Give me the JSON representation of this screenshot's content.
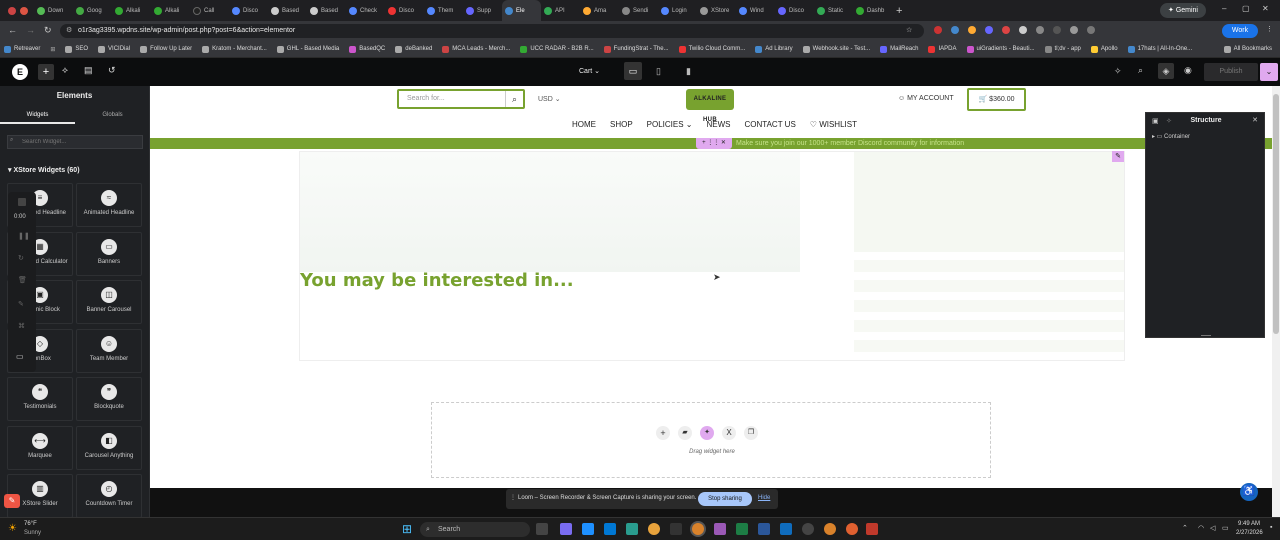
{
  "browser": {
    "tabs": [
      "Down",
      "Goog",
      "Alkali",
      "Alkali",
      "Call",
      "Disco",
      "Based",
      "Based",
      "Check",
      "Disco",
      "Them",
      "Supp",
      "Ele",
      "API",
      "Ama",
      "Sendi",
      "Login",
      "XStore",
      "Wind",
      "Disco",
      "Static",
      "Dashb"
    ],
    "profile": "Gemini",
    "work": "Work",
    "url": "o1r3ag3395.wpdns.site/wp-admin/post.php?post=6&action=elementor",
    "bookmarks": [
      "Retreaver",
      "SEO",
      "VICIDial",
      "Follow Up Later",
      "Kratom - Merchant...",
      "GHL - Based Media",
      "BasedQC",
      "deBanked",
      "MCA Leads - Merch...",
      "UCC RADAR - B2B R...",
      "FundingStrat - The...",
      "Twilio Cloud Comm...",
      "Ad Library",
      "Webhook.site - Test...",
      "MailReach",
      "IAPDA",
      "uiGradients - Beauti...",
      "tl;dv - app",
      "Apollo",
      "17hats | All-In-One..."
    ],
    "all_bookmarks": "All Bookmarks"
  },
  "editor": {
    "cart_label": "Cart",
    "publish": "Publish",
    "sidebar_title": "Elements",
    "tab_widgets": "Widgets",
    "tab_globals": "Globals",
    "search_placeholder": "Search Widget...",
    "category": "XStore Widgets (60)",
    "player_time": "0:00",
    "widgets": [
      {
        "label": "Advanced Headline",
        "icon": "headline-icon"
      },
      {
        "label": "Animated Headline",
        "icon": "animated-headline-icon"
      },
      {
        "label": "Advanced Calculator",
        "icon": "calculator-icon"
      },
      {
        "label": "Banners",
        "icon": "banner-icon"
      },
      {
        "label": "Dynamic Block",
        "icon": "block-icon"
      },
      {
        "label": "Banner Carousel",
        "icon": "carousel-icon"
      },
      {
        "label": "IconBox",
        "icon": "iconbox-icon"
      },
      {
        "label": "Team Member",
        "icon": "team-member-icon"
      },
      {
        "label": "Testimonials",
        "icon": "testimonial-icon"
      },
      {
        "label": "Blockquote",
        "icon": "quote-icon"
      },
      {
        "label": "Marquee",
        "icon": "marquee-icon"
      },
      {
        "label": "Carousel Anything",
        "icon": "carousel-anything-icon"
      },
      {
        "label": "XStore Slider",
        "icon": "slider-icon"
      },
      {
        "label": "Countdown Timer",
        "icon": "timer-icon"
      }
    ],
    "structure_title": "Structure",
    "structure_item": "Container",
    "drag_hint": "Drag widget here"
  },
  "site": {
    "search_placeholder": "Search for...",
    "currency": "USD",
    "logo_text": "ALKALINE HUB",
    "account": "MY ACCOUNT",
    "cart_total": "$360.00",
    "nav": [
      "HOME",
      "SHOP",
      "POLICIES",
      "NEWS",
      "CONTACT US",
      "WISHLIST"
    ],
    "banner": "Make sure you join our 1000+ member Discord community for information",
    "heading": "You may be interested in...",
    "accent": "#78a22f"
  },
  "loom": {
    "message": "Loom – Screen Recorder & Screen Capture is sharing your screen.",
    "stop": "Stop sharing",
    "hide": "Hide"
  },
  "taskbar": {
    "temp": "76°F",
    "weather": "Sunny",
    "search": "Search",
    "time": "9:49 AM",
    "date": "2/27/2026"
  }
}
